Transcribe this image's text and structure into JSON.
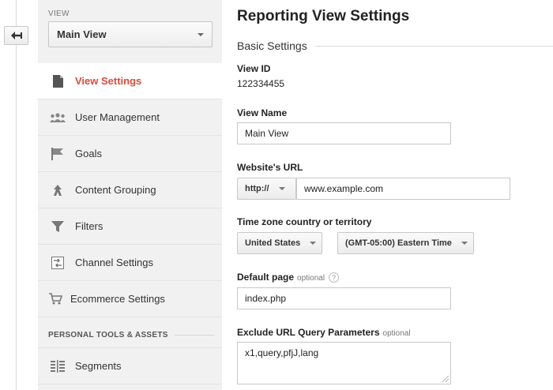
{
  "sidebar": {
    "view_label": "VIEW",
    "view_selected": "Main View",
    "items": [
      {
        "label": "View Settings",
        "icon": "document-icon",
        "active": true
      },
      {
        "label": "User Management",
        "icon": "users-icon",
        "active": false
      },
      {
        "label": "Goals",
        "icon": "flag-icon",
        "active": false
      },
      {
        "label": "Content Grouping",
        "icon": "person-walk-icon",
        "active": false
      },
      {
        "label": "Filters",
        "icon": "funnel-icon",
        "active": false
      },
      {
        "label": "Channel Settings",
        "icon": "channel-settings-icon",
        "active": false
      },
      {
        "label": "Ecommerce Settings",
        "icon": "cart-icon",
        "active": false
      }
    ],
    "tools_heading": "PERSONAL TOOLS & ASSETS",
    "tools": [
      {
        "label": "Segments",
        "icon": "segments-icon"
      }
    ]
  },
  "main": {
    "title": "Reporting View Settings",
    "section": "Basic Settings",
    "view_id_label": "View ID",
    "view_id_value": "122334455",
    "view_name_label": "View Name",
    "view_name_value": "Main View",
    "website_url_label": "Website's URL",
    "protocol": "http://",
    "website_url_value": "www.example.com",
    "timezone_label": "Time zone country or territory",
    "country": "United States",
    "timezone": "(GMT-05:00) Eastern Time",
    "default_page_label": "Default page",
    "optional_label": "optional",
    "default_page_value": "index.php",
    "exclude_label": "Exclude URL Query Parameters",
    "exclude_value": "x1,query,pfjJ,lang"
  },
  "colors": {
    "accent": "#dd4b39",
    "sidebar_bg": "#f1f1f1"
  }
}
